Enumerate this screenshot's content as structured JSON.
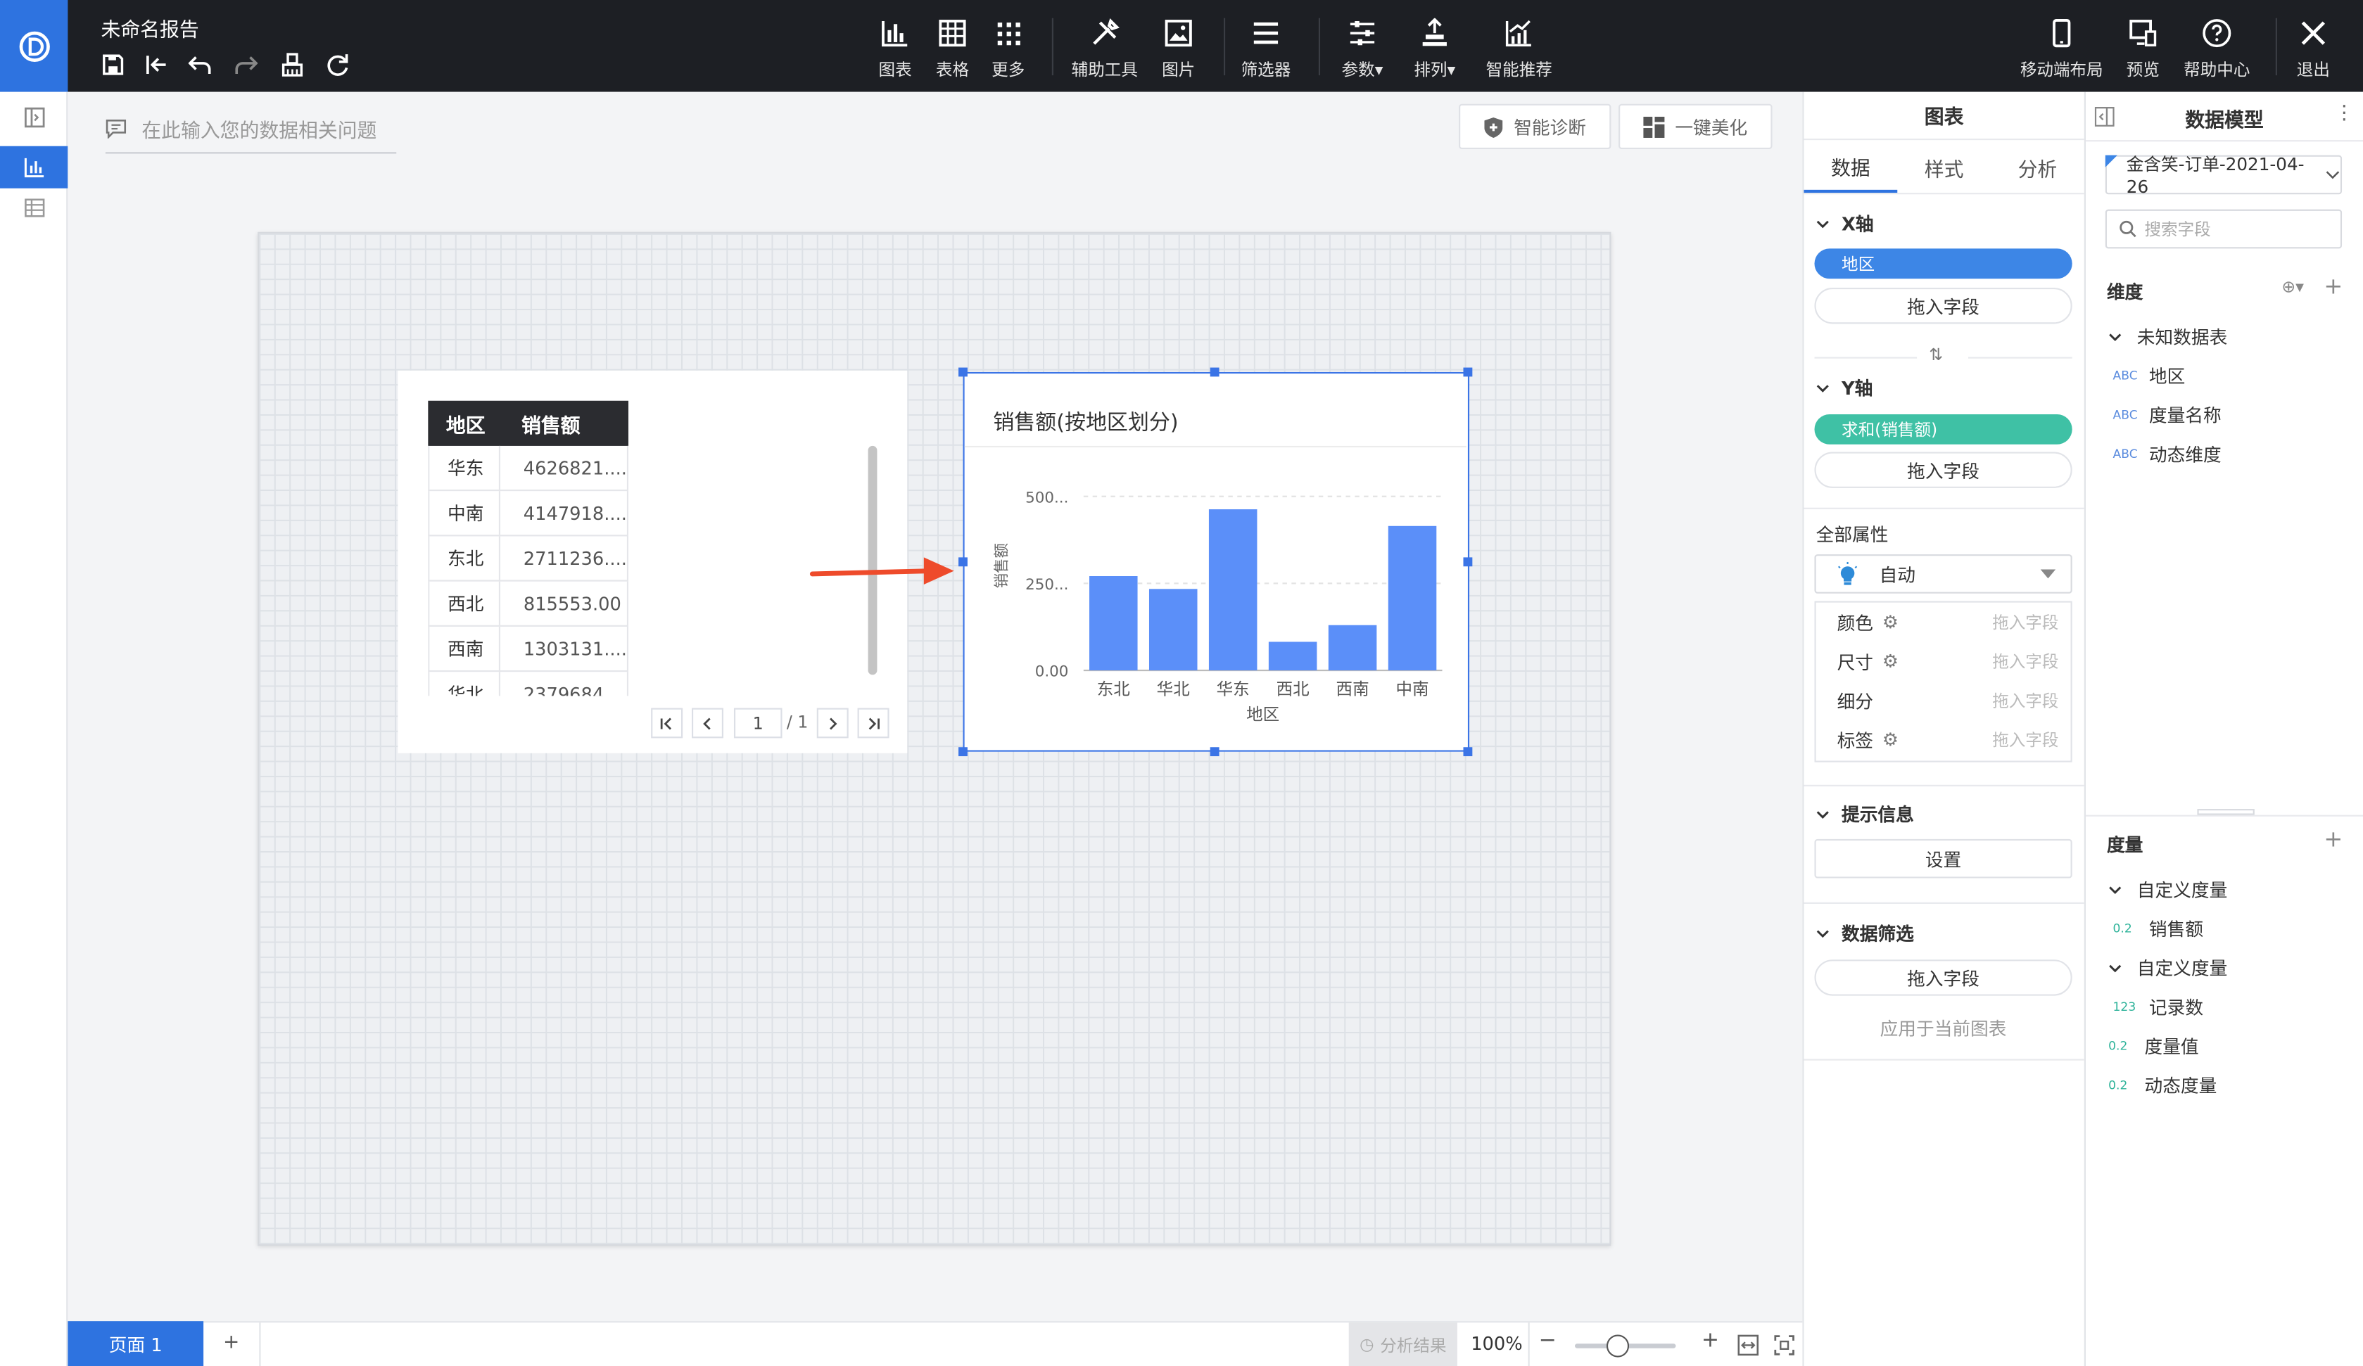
{
  "app": {
    "title": "未命名报告"
  },
  "toolbar": {
    "chart": "图表",
    "table": "表格",
    "more": "更多",
    "aux": "辅助工具",
    "image": "图片",
    "filter": "筛选器",
    "param": "参数",
    "arrange": "排列",
    "smart": "智能推荐",
    "mobile": "移动端布局",
    "preview": "预览",
    "help": "帮助中心",
    "exit": "退出"
  },
  "canvas": {
    "ask_placeholder": "在此输入您的数据相关问题",
    "diagnose": "智能诊断",
    "beautify": "一键美化"
  },
  "table_widget": {
    "headers": [
      "地区",
      "销售额"
    ],
    "rows": [
      [
        "华东",
        "4626821...."
      ],
      [
        "中南",
        "4147918...."
      ],
      [
        "东北",
        "2711236...."
      ],
      [
        "西北",
        "815553.00"
      ],
      [
        "西南",
        "1303131...."
      ],
      [
        "华北",
        "2379684...."
      ]
    ],
    "page_current": "1",
    "page_total": "/ 1"
  },
  "chart_data": {
    "type": "bar",
    "title": "销售额(按地区划分)",
    "categories": [
      "东北",
      "华北",
      "华东",
      "西北",
      "西南",
      "中南"
    ],
    "values": [
      271,
      234,
      463,
      82,
      130,
      415
    ],
    "xlabel": "地区",
    "ylabel": "销售额",
    "ytick_labels": [
      "0.00",
      "250...",
      "500..."
    ],
    "ytick_values": [
      0,
      250,
      500
    ],
    "ylim": [
      0,
      550
    ],
    "color": "#5b8ff9",
    "grid": true
  },
  "panel": {
    "title": "图表",
    "tabs": [
      "数据",
      "样式",
      "分析"
    ],
    "x_axis": "X轴",
    "x_field": "地区",
    "drop_field": "拖入字段",
    "y_axis": "Y轴",
    "y_field": "求和(销售额)",
    "all_props": "全部属性",
    "auto": "自动",
    "props": [
      {
        "label": "颜色"
      },
      {
        "label": "尺寸"
      },
      {
        "label": "细分"
      },
      {
        "label": "标签"
      }
    ],
    "tooltip": "提示信息",
    "settings": "设置",
    "data_filter": "数据筛选",
    "apply_current": "应用于当前图表",
    "swap_icon": "⇅"
  },
  "model": {
    "title": "数据模型",
    "dataset": "金含笑-订单-2021-04-26",
    "search_placeholder": "搜索字段",
    "dimensions": "维度",
    "unknown_table": "未知数据表",
    "dim_fields": [
      {
        "type": "ABC",
        "name": "地区"
      },
      {
        "type": "ABC",
        "name": "度量名称"
      },
      {
        "type": "ABC",
        "name": "动态维度"
      }
    ],
    "measures": "度量",
    "custom1": "自定义度量",
    "m1": [
      {
        "type": "0.2",
        "name": "销售额"
      }
    ],
    "custom2": "自定义度量",
    "m2": [
      {
        "type": "123",
        "name": "记录数"
      },
      {
        "type": "0.2",
        "name": "度量值"
      },
      {
        "type": "0.2",
        "name": "动态度量"
      }
    ]
  },
  "bottom": {
    "page_tab": "页面 1",
    "add": "+",
    "analysis": "分析结果",
    "zoom": "100%",
    "zoom_level": 0.42
  }
}
